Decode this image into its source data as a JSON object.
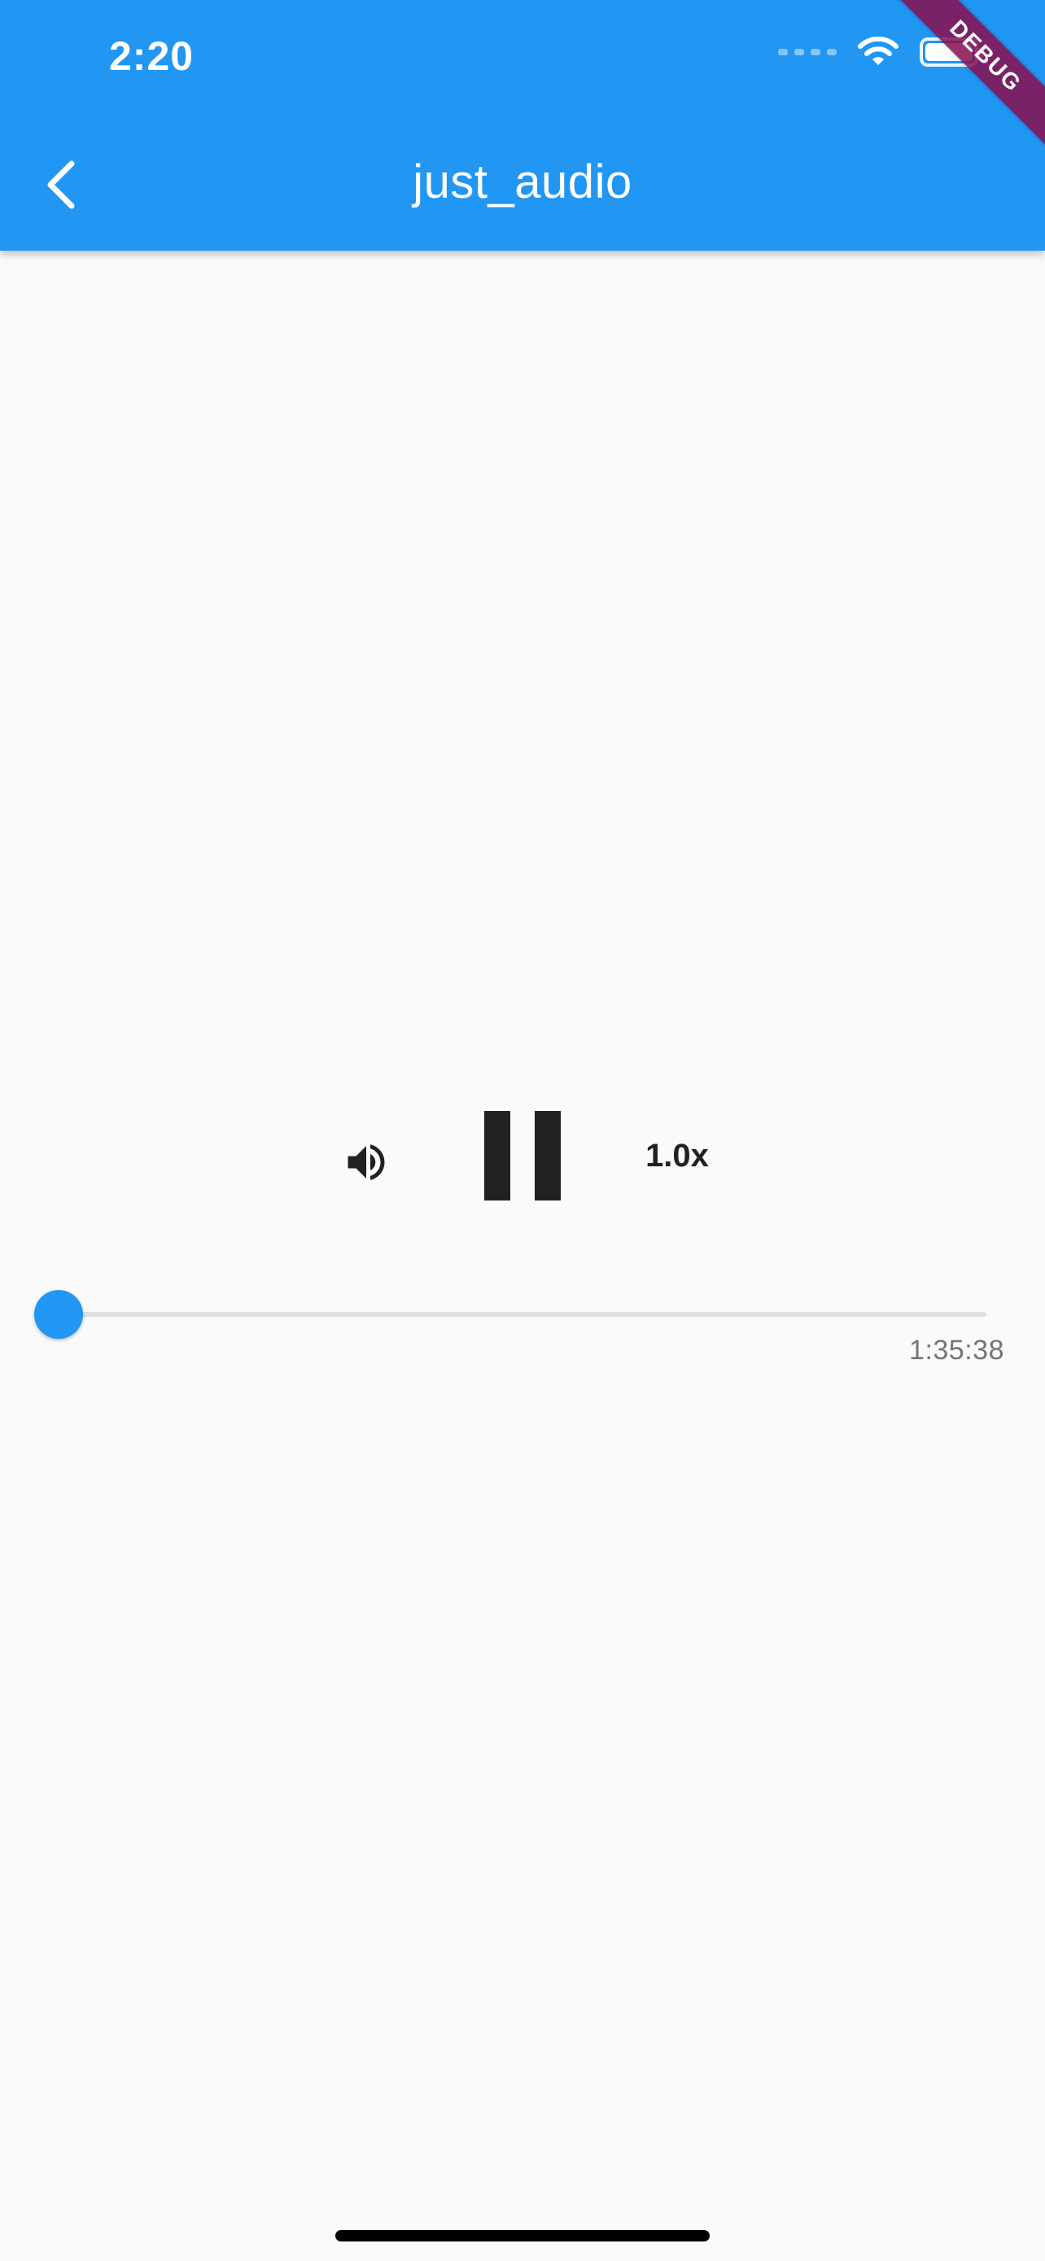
{
  "status_bar": {
    "time": "2:20"
  },
  "app_bar": {
    "title": "just_audio",
    "background_color": "#2196F3",
    "back_icon": "chevron-left-icon"
  },
  "debug_banner": {
    "label": "DEBUG",
    "color": "#880E4F"
  },
  "player": {
    "volume_icon": "volume-up-icon",
    "play_pause_icon": "pause-icon",
    "speed_label": "1.0x",
    "position_fraction": 0.0,
    "duration_label": "1:35:38",
    "accent_color": "#2196F3"
  }
}
